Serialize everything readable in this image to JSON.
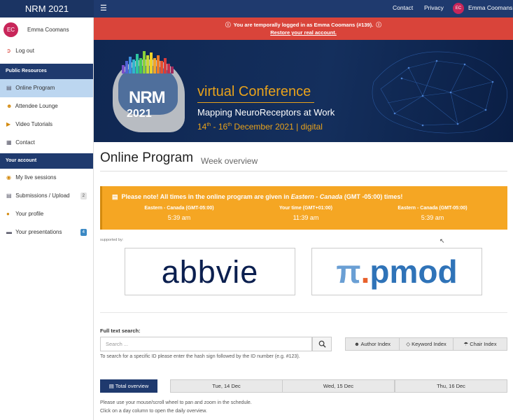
{
  "topbar": {
    "brand": "NRM 2021",
    "menu_icon": "hamburger-icon",
    "links": [
      "Contact",
      "Privacy"
    ],
    "user_initials": "EC",
    "user_name": "Emma Coomans"
  },
  "sidebar": {
    "user_initials": "EC",
    "user_name": "Emma Coomans",
    "logout": "Log out",
    "section_public": "Public Resources",
    "public_items": [
      {
        "label": "Online Program",
        "icon": "calendar-icon",
        "active": true
      },
      {
        "label": "Attendee Lounge",
        "icon": "people-icon"
      },
      {
        "label": "Video Tutorials",
        "icon": "video-icon"
      },
      {
        "label": "Contact",
        "icon": "contact-icon"
      }
    ],
    "section_account": "Your account",
    "account_items": [
      {
        "label": "My live sessions",
        "icon": "live-icon"
      },
      {
        "label": "Submissions / Upload",
        "icon": "document-icon",
        "badge": "2"
      },
      {
        "label": "Your profile",
        "icon": "user-icon"
      },
      {
        "label": "Your presentations",
        "icon": "presentation-icon",
        "badge": "4"
      }
    ]
  },
  "alert": {
    "line1": "You are temporally logged in as Emma Coomans (#139).",
    "line2": "Restore your real account."
  },
  "banner": {
    "title": "NRM",
    "year": "2021",
    "conference": "virtual Conference",
    "subtitle": "Mapping NeuroReceptors at Work",
    "date_start": "14",
    "date_start_sup": "th",
    "date_mid": " - 16",
    "date_end_sup": "th",
    "date_rest": " December 2021 | digital"
  },
  "page": {
    "title": "Online Program",
    "subtitle": "Week overview"
  },
  "notice": {
    "lead": "Please note! All times in the online program are given in",
    "timezone": "Eastern - Canada",
    "tail": "(GMT -05:00) times!",
    "columns": [
      {
        "label": "Eastern - Canada (GMT-05:00)",
        "time": "5:39 am"
      },
      {
        "label": "Your time (GMT+01:00)",
        "time": "11:39 am"
      },
      {
        "label": "Eastern - Canada (GMT-05:00)",
        "time": "5:39 am"
      }
    ]
  },
  "sponsors": {
    "supported_by": "supported by:",
    "logo1": "abbvie",
    "logo2_pi": "π",
    "logo2_dot": ".",
    "logo2_text": "pmod"
  },
  "search": {
    "label": "Full text search:",
    "placeholder": "Search ...",
    "hint": "To search for a specific ID please enter the hash sign followed by the ID number (e.g. #123).",
    "index_buttons": [
      "Author Index",
      "Keyword Index",
      "Chair Index"
    ]
  },
  "schedule": {
    "total_label": "Total overview",
    "days": [
      "Tue, 14 Dec",
      "Wed, 15 Dec",
      "Thu, 16 Dec"
    ],
    "note1": "Please use your mouse/scroll wheel to pan and zoom in the schedule.",
    "note2": "Click on a day column to open the daily overview."
  },
  "colors": {
    "navy": "#1f3a6e",
    "alert_red": "#d9443a",
    "notice_orange": "#f5a623",
    "active_blue": "#bcd6f0",
    "avatar": "#c8265a"
  }
}
